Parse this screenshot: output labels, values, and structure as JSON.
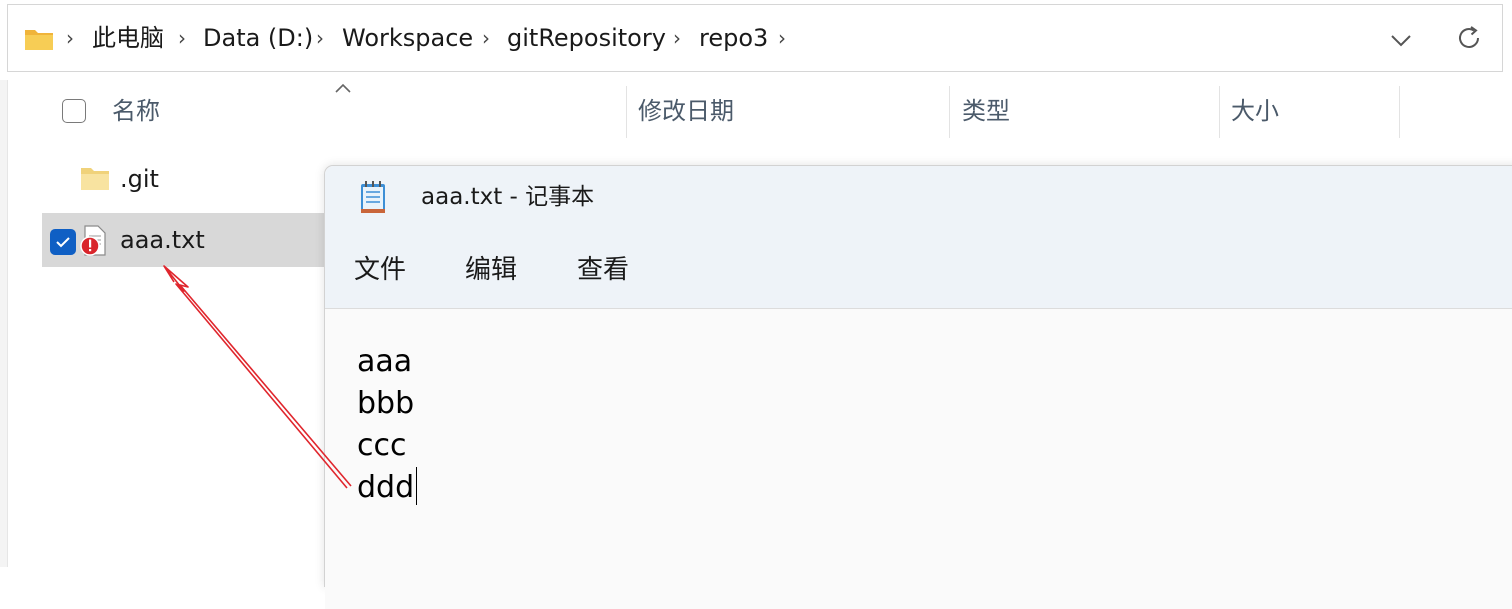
{
  "breadcrumb": {
    "items": [
      "此电脑",
      "Data (D:)",
      "Workspace",
      "gitRepository",
      "repo3"
    ],
    "separator": "›"
  },
  "columns": {
    "name": "名称",
    "modified": "修改日期",
    "type": "类型",
    "size": "大小"
  },
  "files": [
    {
      "name": ".git",
      "kind": "folder",
      "selected": false
    },
    {
      "name": "aaa.txt",
      "kind": "text-file-with-conflict-overlay",
      "selected": true
    }
  ],
  "notepad": {
    "title": "aaa.txt - 记事本",
    "menu": [
      "文件",
      "编辑",
      "查看"
    ],
    "lines": [
      "aaa",
      "bbb",
      "ccc",
      "ddd"
    ]
  },
  "colors": {
    "folder": "#f5c84c",
    "selection_check": "#0f5fc4",
    "annotation_arrow": "#e0262d",
    "overlay_badge": "#d9262c"
  },
  "icons": [
    "folder-icon",
    "chevron-right-icon",
    "chevron-down-icon",
    "refresh-icon",
    "sort-caret-icon",
    "notepad-icon",
    "text-file-icon",
    "conflict-badge-icon",
    "checkmark-icon"
  ]
}
